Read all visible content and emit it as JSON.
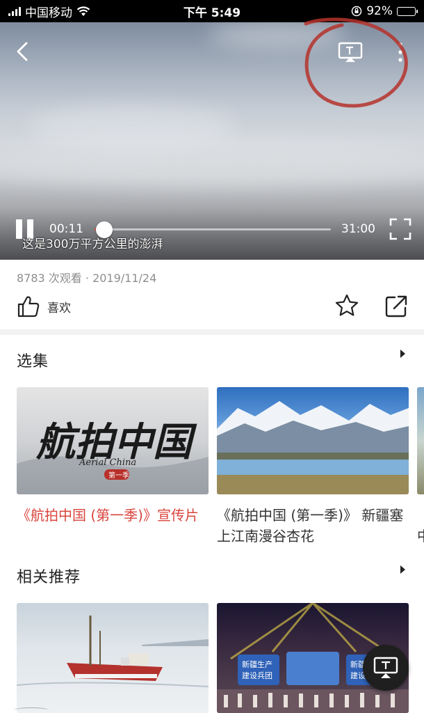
{
  "status_bar": {
    "carrier": "中国移动",
    "time": "下午 5:49",
    "battery": "92%",
    "battery_level": 0.92
  },
  "player": {
    "current_time": "00:11",
    "duration": "31:00",
    "progress": 0.006,
    "subtitle": "这是300万平方公里的澎湃",
    "icons": [
      "back-arrow-icon",
      "tv-cast-icon",
      "more-vertical-icon",
      "pause-icon",
      "fullscreen-icon"
    ]
  },
  "video_info": {
    "meta": "8783 次观看 · 2019/11/24",
    "like_label": "喜欢"
  },
  "episodes": {
    "title": "选集",
    "items": [
      {
        "title": "《航拍中国 (第一季)》宣传片",
        "active": true,
        "thumb_title": "航拍中国",
        "thumb_subtitle": "Aerial China",
        "thumb_badge": "第一季"
      },
      {
        "title": "《航拍中国 (第一季)》 新疆塞上江南漫谷杏花",
        "active": false
      }
    ],
    "next_peek": "中"
  },
  "related": {
    "title": "相关推荐",
    "items": [
      {
        "thumb": "ship-on-ice"
      },
      {
        "thumb": "stage-event",
        "stage_texts": [
          "新疆生产",
          "建设兵团",
          "新疆",
          "建设"
        ]
      }
    ]
  },
  "colors": {
    "accent_red": "#d9453d",
    "text_primary": "#222222",
    "text_secondary": "#8e8e8e"
  }
}
